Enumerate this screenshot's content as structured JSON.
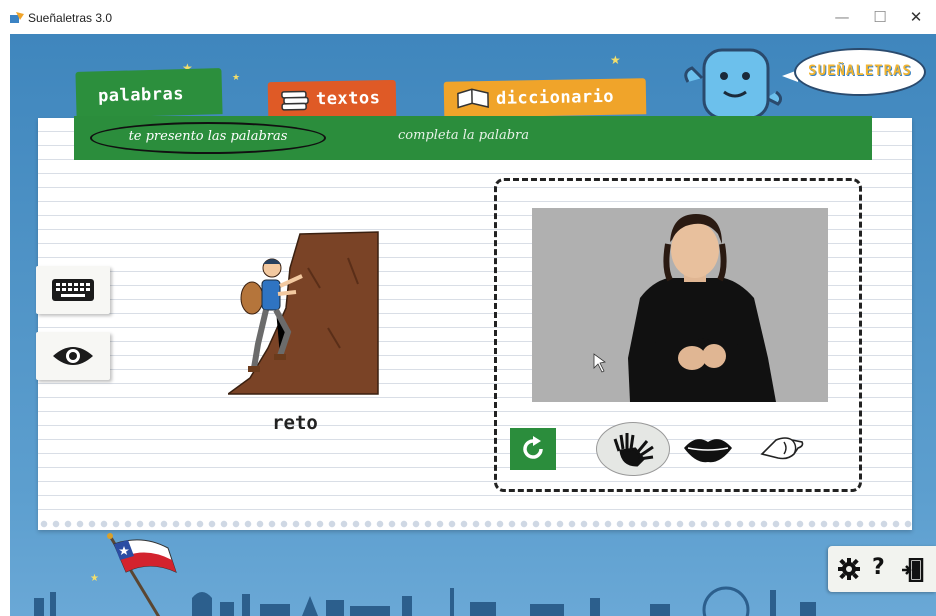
{
  "window": {
    "title": "Sueñaletras 3.0",
    "minimize_glyph": "—",
    "maximize_glyph": "☐",
    "close_glyph": "✕"
  },
  "logo": {
    "text": "SUEÑALETRAS"
  },
  "tabs": [
    {
      "label": "palabras",
      "color": "#2c8f3d",
      "icon": null,
      "active": true
    },
    {
      "label": "textos",
      "color": "#df5a26",
      "icon": "book-icon",
      "active": false
    },
    {
      "label": "diccionario",
      "color": "#f0a42a",
      "icon": "book-open-icon",
      "active": false
    }
  ],
  "subnav": [
    {
      "label": "te presento las palabras",
      "active": true
    },
    {
      "label": "completa la palabra",
      "active": false
    }
  ],
  "word": {
    "text": "reto"
  },
  "side_buttons": [
    {
      "icon": "keyboard-icon"
    },
    {
      "icon": "eye-icon"
    }
  ],
  "video_controls": [
    {
      "icon": "replay-icon"
    },
    {
      "icon": "sign-hands-icon",
      "selected": true
    },
    {
      "icon": "lips-icon"
    },
    {
      "icon": "fingerspelling-icon"
    }
  ],
  "bottom_toolbar": [
    {
      "icon": "gear-icon"
    },
    {
      "icon": "help-icon",
      "glyph": "?"
    },
    {
      "icon": "exit-door-icon"
    }
  ],
  "colors": {
    "background": "#4f93c6",
    "green": "#2b8d3c",
    "orange": "#df5a26",
    "yellow": "#f0a42a"
  }
}
